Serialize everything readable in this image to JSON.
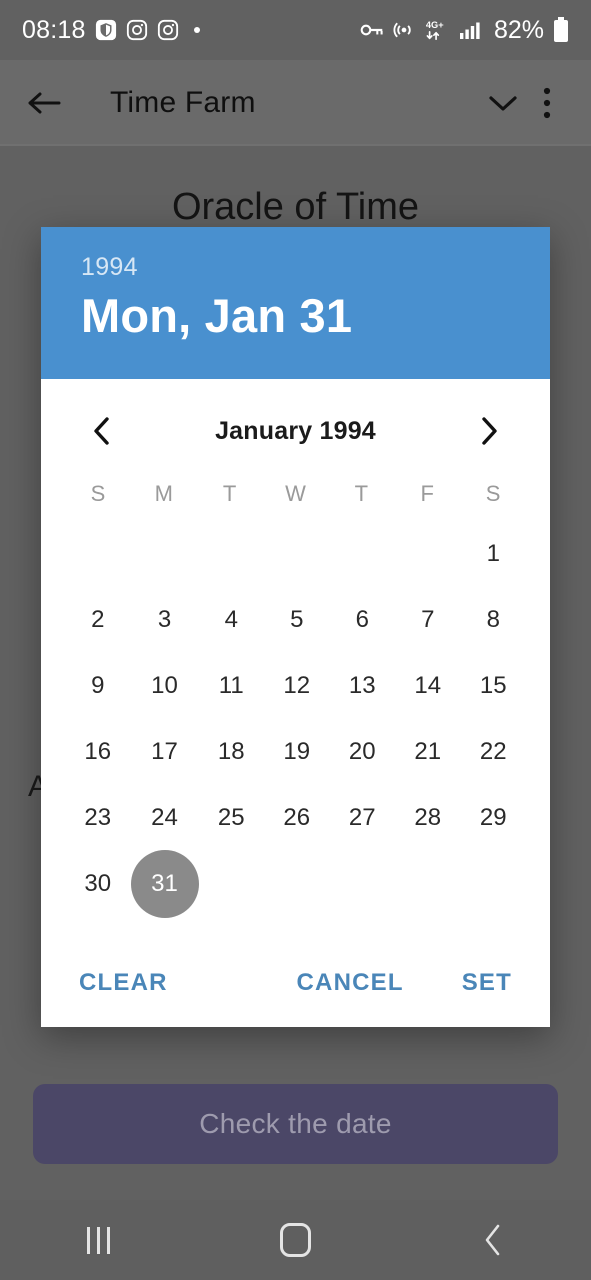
{
  "status_bar": {
    "clock": "08:18",
    "left_icons": [
      "shield-icon",
      "instagram-icon",
      "instagram-icon",
      "dot-icon"
    ],
    "right_icons": [
      "key-icon",
      "hotspot-icon",
      "network-4g-plus-icon",
      "signal-bars-icon"
    ],
    "network_label": "4G+",
    "battery_percent": "82%"
  },
  "app_bar": {
    "back_label": "Back",
    "title": "Time Farm",
    "collapse_label": "Collapse",
    "overflow_label": "More options"
  },
  "page": {
    "heading": "Oracle of Time",
    "partial_text": "A",
    "cta_label": "Check the date"
  },
  "dialog": {
    "header": {
      "year": "1994",
      "date_text": "Mon, Jan 31"
    },
    "month_nav": {
      "prev_label": "Previous month",
      "month_label": "January 1994",
      "next_label": "Next month"
    },
    "weekdays": [
      "S",
      "M",
      "T",
      "W",
      "T",
      "F",
      "S"
    ],
    "weeks": [
      [
        "",
        "",
        "",
        "",
        "",
        "",
        "1"
      ],
      [
        "2",
        "3",
        "4",
        "5",
        "6",
        "7",
        "8"
      ],
      [
        "9",
        "10",
        "11",
        "12",
        "13",
        "14",
        "15"
      ],
      [
        "16",
        "17",
        "18",
        "19",
        "20",
        "21",
        "22"
      ],
      [
        "23",
        "24",
        "25",
        "26",
        "27",
        "28",
        "29"
      ],
      [
        "30",
        "31",
        "",
        "",
        "",
        "",
        ""
      ]
    ],
    "selected_day": "31",
    "actions": {
      "clear": "CLEAR",
      "cancel": "CANCEL",
      "set": "SET"
    }
  },
  "nav_bar": {
    "recents_label": "Recents",
    "home_label": "Home",
    "back_label": "Back"
  },
  "colors": {
    "dialog_header_blue": "#4990cf",
    "action_blue": "#4a86b8",
    "selected_day_gray": "#8a8a8a",
    "cta_indigo": "#4b4767",
    "scrim_gray": "#616161"
  }
}
